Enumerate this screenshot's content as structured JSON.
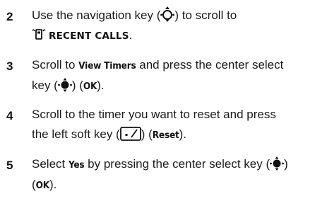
{
  "steps": [
    {
      "number": "2",
      "line1_a": "Use the navigation key (",
      "nav_icon": "navigation-key-icon",
      "line1_b": ") to scroll to",
      "menu_icon": "recent-calls-icon",
      "menu_label": "RECENT CALLS",
      "line2_end": "."
    },
    {
      "number": "3",
      "a": "Scroll to ",
      "term": "View Timers",
      "b": " and press the center select",
      "c": "key (",
      "select_icon": "center-select-key-icon",
      "d": ") (",
      "ok": "OK",
      "e": ")."
    },
    {
      "number": "4",
      "line1": "Scroll to the timer you want to reset and press",
      "a": "the left soft key (",
      "soft_icon": "left-soft-key-icon",
      "b": ") (",
      "reset": "Reset",
      "c": ")."
    },
    {
      "number": "5",
      "a": "Select ",
      "yes": "Yes",
      "b": " by pressing the center select key (",
      "select_icon": "center-select-key-icon",
      "c": ")",
      "d": "(",
      "ok": "OK",
      "e": ")."
    }
  ]
}
